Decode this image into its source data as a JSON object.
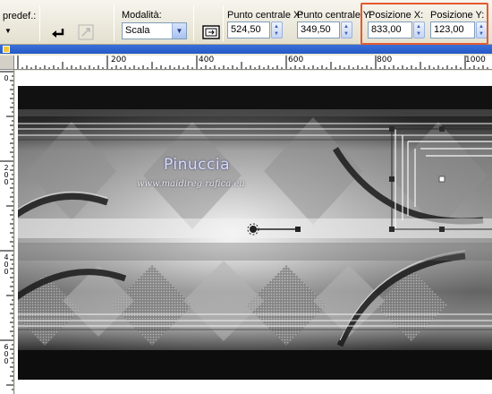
{
  "toolbar": {
    "preset_label": "predef.:",
    "mode_label": "Modalità:",
    "mode_value": "Scala",
    "center_x_label": "Punto centrale X:",
    "center_x_value": "524,50",
    "center_y_label": "Punto centrale Y:",
    "center_y_value": "349,50",
    "pos_x_label": "Posizione X:",
    "pos_x_value": "833,00",
    "pos_y_label": "Posizione Y:",
    "pos_y_value": "123,00"
  },
  "ruler": {
    "top_labels": [
      "200",
      "400",
      "600",
      "800",
      "1000"
    ],
    "left_labels": [
      "0",
      "200",
      "400",
      "600"
    ]
  },
  "canvas": {
    "watermark": "Pinuccia",
    "watermark_url": "www.maidireg rafica.eu"
  },
  "colors": {
    "highlight": "#e55a2d",
    "title_bar": "#2459c6"
  }
}
